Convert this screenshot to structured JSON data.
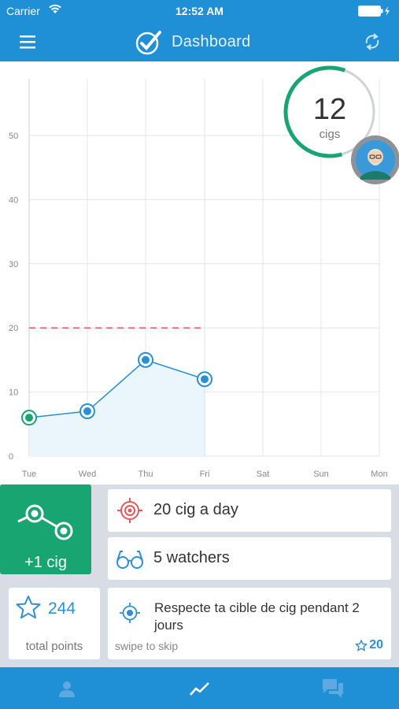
{
  "status_bar": {
    "carrier": "Carrier",
    "time": "12:52 AM",
    "icons": [
      "wifi-icon",
      "battery-icon",
      "charging-icon"
    ]
  },
  "nav": {
    "title": "Dashboard",
    "icons": [
      "menu-icon",
      "checkmark-logo-icon",
      "sync-icon"
    ]
  },
  "counter": {
    "count": "12",
    "unit": "cigs",
    "progress_fraction": 0.6,
    "accent": "#18a572"
  },
  "chart_data": {
    "type": "area",
    "categories": [
      "Tue",
      "Wed",
      "Thu",
      "Fri",
      "Sat",
      "Sun",
      "Mon"
    ],
    "y_ticks": [
      "0",
      "10",
      "20",
      "30",
      "40",
      "50"
    ],
    "ylim": [
      0,
      58
    ],
    "series": [
      {
        "values": [
          6,
          7,
          15,
          12,
          null,
          null,
          null
        ]
      }
    ],
    "target_line": 20,
    "grid": true,
    "colors": {
      "line": "#2a8fd4",
      "fill": "#eaf6fb",
      "target": "#e8575a",
      "grid": "#e4e4e4",
      "first_point": "#18a572"
    }
  },
  "actions": {
    "add_cig_label": "+1 cig",
    "goal_label": "20 cig a day",
    "watchers_label": "5 watchers"
  },
  "points": {
    "value": "244",
    "caption": "total points"
  },
  "challenge": {
    "text": "Respecte ta cible de cig pendant 2 jours",
    "skip_hint": "swipe to skip",
    "reward": "20"
  },
  "tabs": [
    {
      "icon": "profile-icon"
    },
    {
      "icon": "trend-icon",
      "active": true
    },
    {
      "icon": "chat-icon"
    }
  ]
}
